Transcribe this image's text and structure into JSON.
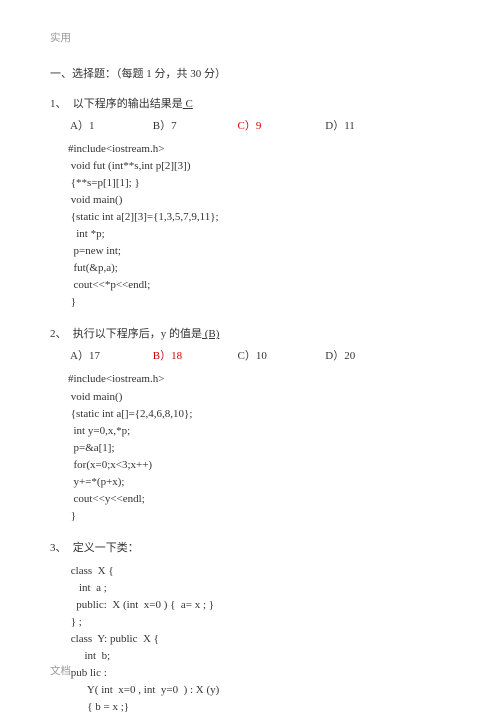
{
  "header": "实用",
  "footer": "文档",
  "section_title": "一、选择题：（每题 1 分，共 30 分）",
  "q1": {
    "num": "1、",
    "stem_pre": "以下程序的输出结果是",
    "ans": "   C   ",
    "optA": "A）1",
    "optB": "B）7",
    "optC": "C）9",
    "optD": "D）11",
    "code": [
      "#include<iostream.h>",
      " void fut (int**s,int p[2][3])",
      " {**s=p[1][1]; }",
      " void main()",
      " {static int a[2][3]={1,3,5,7,9,11};",
      "   int *p;",
      "  p=new int;",
      "  fut(&p,a);",
      "  cout<<*p<<endl;",
      " }"
    ]
  },
  "q2": {
    "num": "2、",
    "stem_pre": "执行以下程序后，y 的值是",
    "ans": " (B) ",
    "optA": "A）17",
    "optB": "B）18",
    "optC": "C）10",
    "optD": "D）20",
    "code": [
      "#include<iostream.h>",
      " void main()",
      " {static int a[]={2,4,6,8,10};",
      "  int y=0,x,*p;",
      "  p=&a[1];",
      "  for(x=0;x<3;x++)",
      "  y+=*(p+x);",
      "  cout<<y<<endl;",
      " }"
    ]
  },
  "q3": {
    "num": "3、",
    "stem": "定义一下类：",
    "code": [
      " class  X {",
      "    int  a ;",
      "   public:  X (int  x=0 ) {  a= x ; }",
      " } ;",
      " class  Y: public  X {",
      "      int  b;",
      " pub lic :",
      "       Y( int  x=0 , int  y=0  ) : X (y)",
      "       { b = x ;}"
    ]
  }
}
